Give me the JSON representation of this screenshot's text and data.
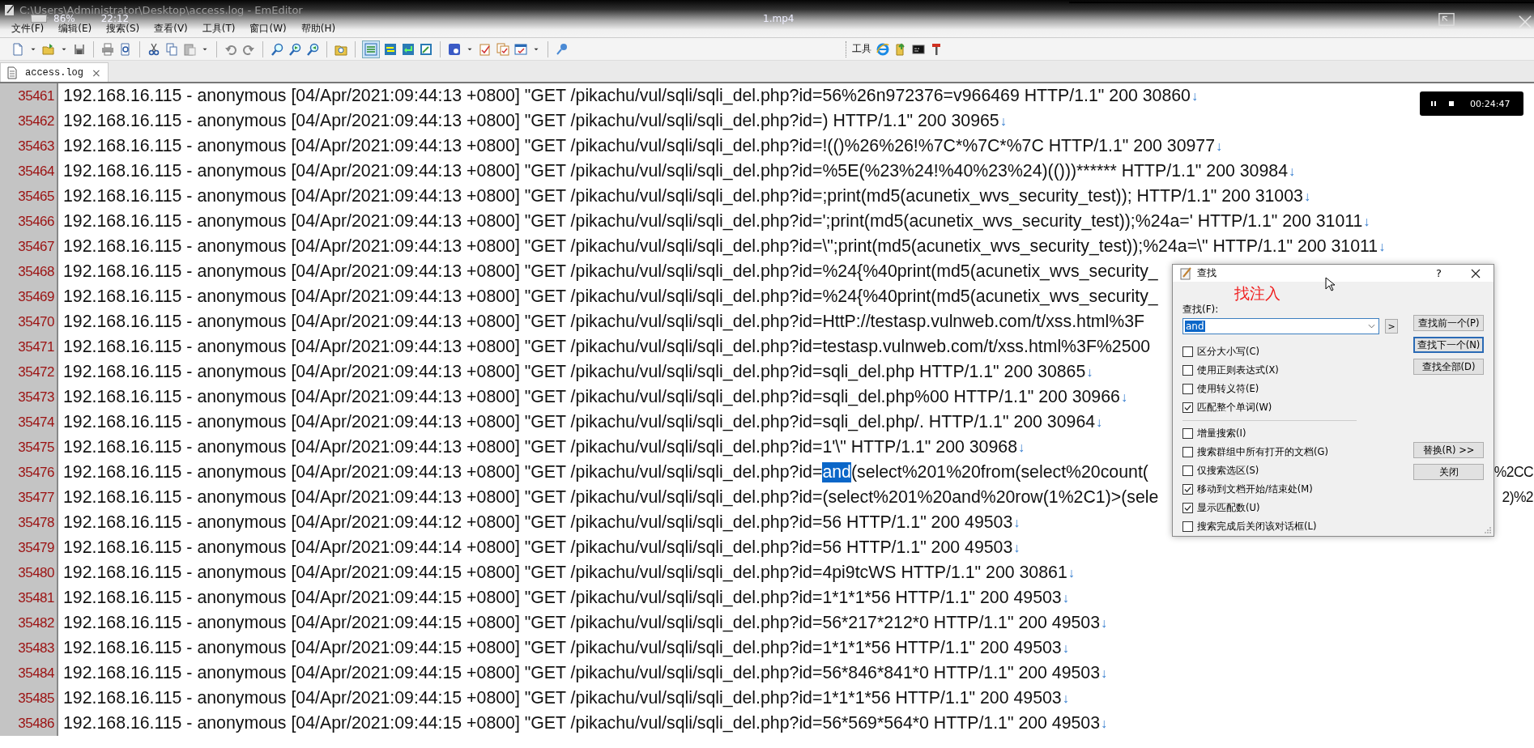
{
  "window": {
    "title": "C:\\Users\\Administrator\\Desktop\\access.log - EmEditor"
  },
  "player_overlay": {
    "battery": "86%",
    "clock": "22:12",
    "file": "1.mp4",
    "elapsed": "00:24:47"
  },
  "menu": [
    "文件(F)",
    "编辑(E)",
    "搜索(S)",
    "查看(V)",
    "工具(T)",
    "窗口(W)",
    "帮助(H)"
  ],
  "tools_label": "工具",
  "tabs": [
    {
      "label": "access.log",
      "selected": true,
      "close": "×"
    }
  ],
  "lines": [
    {
      "number": "35461",
      "text": "192.168.16.115 - anonymous [04/Apr/2021:09:44:13 +0800] \"GET /pikachu/vul/sqli/sqli_del.php?id=56%26n972376=v966469 HTTP/1.1\" 200 30860",
      "eol": "↓"
    },
    {
      "number": "35462",
      "text": "192.168.16.115 - anonymous [04/Apr/2021:09:44:13 +0800] \"GET /pikachu/vul/sqli/sqli_del.php?id=) HTTP/1.1\" 200 30965",
      "eol": "↓"
    },
    {
      "number": "35463",
      "text": "192.168.16.115 - anonymous [04/Apr/2021:09:44:13 +0800] \"GET /pikachu/vul/sqli/sqli_del.php?id=!(()%26%26!%7C*%7C*%7C HTTP/1.1\" 200 30977",
      "eol": "↓"
    },
    {
      "number": "35464",
      "text": "192.168.16.115 - anonymous [04/Apr/2021:09:44:13 +0800] \"GET /pikachu/vul/sqli/sqli_del.php?id=%5E(%23%24!%40%23%24)(()))****** HTTP/1.1\" 200 30984",
      "eol": "↓"
    },
    {
      "number": "35465",
      "text": "192.168.16.115 - anonymous [04/Apr/2021:09:44:13 +0800] \"GET /pikachu/vul/sqli/sqli_del.php?id=;print(md5(acunetix_wvs_security_test)); HTTP/1.1\" 200 31003",
      "eol": "↓"
    },
    {
      "number": "35466",
      "text": "192.168.16.115 - anonymous [04/Apr/2021:09:44:13 +0800] \"GET /pikachu/vul/sqli/sqli_del.php?id=';print(md5(acunetix_wvs_security_test));%24a=' HTTP/1.1\" 200 31011",
      "eol": "↓"
    },
    {
      "number": "35467",
      "text": "192.168.16.115 - anonymous [04/Apr/2021:09:44:13 +0800] \"GET /pikachu/vul/sqli/sqli_del.php?id=\\\";print(md5(acunetix_wvs_security_test));%24a=\\\" HTTP/1.1\" 200 31011",
      "eol": "↓"
    },
    {
      "number": "35468",
      "text": "192.168.16.115 - anonymous [04/Apr/2021:09:44:13 +0800] \"GET /pikachu/vul/sqli/sqli_del.php?id=%24{%40print(md5(acunetix_wvs_security_"
    },
    {
      "number": "35469",
      "text": "192.168.16.115 - anonymous [04/Apr/2021:09:44:13 +0800] \"GET /pikachu/vul/sqli/sqli_del.php?id=%24{%40print(md5(acunetix_wvs_security_"
    },
    {
      "number": "35470",
      "text": "192.168.16.115 - anonymous [04/Apr/2021:09:44:13 +0800] \"GET /pikachu/vul/sqli/sqli_del.php?id=HttP://testasp.vulnweb.com/t/xss.html%3F"
    },
    {
      "number": "35471",
      "text": "192.168.16.115 - anonymous [04/Apr/2021:09:44:13 +0800] \"GET /pikachu/vul/sqli/sqli_del.php?id=testasp.vulnweb.com/t/xss.html%3F%2500"
    },
    {
      "number": "35472",
      "text": "192.168.16.115 - anonymous [04/Apr/2021:09:44:13 +0800] \"GET /pikachu/vul/sqli/sqli_del.php?id=sqli_del.php HTTP/1.1\" 200 30865",
      "eol": "↓"
    },
    {
      "number": "35473",
      "text": "192.168.16.115 - anonymous [04/Apr/2021:09:44:13 +0800] \"GET /pikachu/vul/sqli/sqli_del.php?id=sqli_del.php%00 HTTP/1.1\" 200 30966",
      "eol": "↓"
    },
    {
      "number": "35474",
      "text": "192.168.16.115 - anonymous [04/Apr/2021:09:44:13 +0800] \"GET /pikachu/vul/sqli/sqli_del.php?id=sqli_del.php/. HTTP/1.1\" 200 30964",
      "eol": "↓"
    },
    {
      "number": "35475",
      "text": "192.168.16.115 - anonymous [04/Apr/2021:09:44:13 +0800] \"GET /pikachu/vul/sqli/sqli_del.php?id=1'\\\" HTTP/1.1\" 200 30968",
      "eol": "↓"
    },
    {
      "number": "35476",
      "segments": [
        {
          "text": "192.168.16.115 - anonymous [04/Apr/2021:09:44:13 +0800] \"GET /pikachu/vul/sqli/sqli_del.php?id=",
          "highlighted": false
        },
        {
          "text": "and",
          "highlighted": true
        },
        {
          "text": "(select%201%20from(select%20count(",
          "highlighted": false
        }
      ],
      "tail": "%2CC"
    },
    {
      "number": "35477",
      "text": "192.168.16.115 - anonymous [04/Apr/2021:09:44:13 +0800] \"GET /pikachu/vul/sqli/sqli_del.php?id=(select%201%20and%20row(1%2C1)>(sele",
      "tail": "2)%2"
    },
    {
      "number": "35478",
      "text": "192.168.16.115 - anonymous [04/Apr/2021:09:44:12 +0800] \"GET /pikachu/vul/sqli/sqli_del.php?id=56 HTTP/1.1\" 200 49503",
      "eol": "↓"
    },
    {
      "number": "35479",
      "text": "192.168.16.115 - anonymous [04/Apr/2021:09:44:14 +0800] \"GET /pikachu/vul/sqli/sqli_del.php?id=56 HTTP/1.1\" 200 49503",
      "eol": "↓"
    },
    {
      "number": "35480",
      "text": "192.168.16.115 - anonymous [04/Apr/2021:09:44:15 +0800] \"GET /pikachu/vul/sqli/sqli_del.php?id=4pi9tcWS HTTP/1.1\" 200 30861",
      "eol": "↓"
    },
    {
      "number": "35481",
      "text": "192.168.16.115 - anonymous [04/Apr/2021:09:44:15 +0800] \"GET /pikachu/vul/sqli/sqli_del.php?id=1*1*1*56 HTTP/1.1\" 200 49503",
      "eol": "↓"
    },
    {
      "number": "35482",
      "text": "192.168.16.115 - anonymous [04/Apr/2021:09:44:15 +0800] \"GET /pikachu/vul/sqli/sqli_del.php?id=56*217*212*0 HTTP/1.1\" 200 49503",
      "eol": "↓"
    },
    {
      "number": "35483",
      "text": "192.168.16.115 - anonymous [04/Apr/2021:09:44:15 +0800] \"GET /pikachu/vul/sqli/sqli_del.php?id=1*1*1*56 HTTP/1.1\" 200 49503",
      "eol": "↓"
    },
    {
      "number": "35484",
      "text": "192.168.16.115 - anonymous [04/Apr/2021:09:44:15 +0800] \"GET /pikachu/vul/sqli/sqli_del.php?id=56*846*841*0 HTTP/1.1\" 200 49503",
      "eol": "↓"
    },
    {
      "number": "35485",
      "text": "192.168.16.115 - anonymous [04/Apr/2021:09:44:15 +0800] \"GET /pikachu/vul/sqli/sqli_del.php?id=1*1*1*56 HTTP/1.1\" 200 49503",
      "eol": "↓"
    },
    {
      "number": "35486",
      "text": "192.168.16.115 - anonymous [04/Apr/2021:09:44:15 +0800] \"GET /pikachu/vul/sqli/sqli_del.php?id=56*569*564*0 HTTP/1.1\" 200 49503",
      "eol": "↓"
    }
  ],
  "find_dialog": {
    "title": "查找",
    "help": "?",
    "annotation": "找注入",
    "find_label": "查找(F):",
    "find_value": "and",
    "expand_button": ">",
    "buttons": [
      {
        "label": "查找前一个(P)",
        "default": false
      },
      {
        "label": "查找下一个(N)",
        "default": true
      },
      {
        "label": "查找全部(D)",
        "default": false
      }
    ],
    "options": [
      {
        "label": "区分大小写(C)",
        "checked": false
      },
      {
        "label": "使用正则表达式(X)",
        "checked": false
      },
      {
        "label": "使用转义符(E)",
        "checked": false
      },
      {
        "label": "匹配整个单词(W)",
        "checked": true
      }
    ],
    "more_options": [
      {
        "label": "增量搜索(I)",
        "checked": false
      },
      {
        "label": "搜索群组中所有打开的文档(G)",
        "checked": false
      },
      {
        "label": "仅搜索选区(S)",
        "checked": false
      },
      {
        "label": "移动到文档开始/结束处(M)",
        "checked": true
      },
      {
        "label": "显示匹配数(U)",
        "checked": true
      },
      {
        "label": "搜索完成后关闭该对话框(L)",
        "checked": false
      }
    ],
    "side_buttons": [
      {
        "label": "替换(R) >>",
        "default": false
      },
      {
        "label": "关闭",
        "default": false
      }
    ]
  }
}
